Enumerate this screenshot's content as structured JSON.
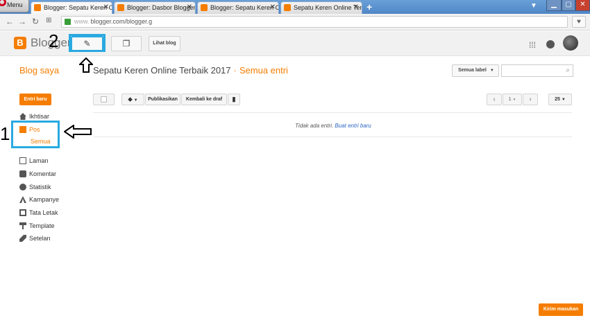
{
  "browser": {
    "menu_label": "Menu",
    "tabs": [
      {
        "title": "Blogger: Sepatu Keren Onl",
        "active": true
      },
      {
        "title": "Blogger: Dasbor Blogger",
        "active": false
      },
      {
        "title": "Blogger: Sepatu Keren On",
        "active": false
      },
      {
        "title": "Sepatu Keren Online Terba",
        "active": false
      }
    ],
    "tab_close": "✕",
    "new_tab": "+",
    "url_scheme": "www.",
    "url": "blogger.com/blogger.g"
  },
  "header": {
    "brand": "Blogger",
    "view_blog_label": "Lihat blog"
  },
  "annotations": {
    "num1": "1",
    "num2": "2",
    "box_color": "#29a9e0"
  },
  "title_row": {
    "my_blogs": "Blog saya",
    "blog_name": "Sepatu Keren Online Terbaik 2017",
    "dot": "·",
    "section": "Semua entri",
    "label_filter": "Semua label"
  },
  "sidebar": {
    "new_post": "Entri baru",
    "items": [
      {
        "label": "Ikhtisar",
        "icon": "home-icon"
      },
      {
        "label": "Pos",
        "icon": "posts-icon"
      },
      {
        "label": "Laman",
        "icon": "pages-icon"
      },
      {
        "label": "Komentar",
        "icon": "comment-icon"
      },
      {
        "label": "Statistik",
        "icon": "stats-icon"
      },
      {
        "label": "Kampanye",
        "icon": "campaign-icon"
      },
      {
        "label": "Tata Letak",
        "icon": "layout-icon"
      },
      {
        "label": "Template",
        "icon": "template-icon"
      },
      {
        "label": "Setelan",
        "icon": "wrench-icon"
      }
    ],
    "sub_all": "Semua"
  },
  "toolbar": {
    "publish": "Publikasikan",
    "revert_draft": "Kembali ke draf",
    "page": "1",
    "page_size": "25"
  },
  "content": {
    "empty_text": "Tidak ada entri.",
    "create_link": "Buat entri baru"
  },
  "feedback": "Kirim masukan",
  "colors": {
    "accent": "#f57d00",
    "link": "#2a66c1"
  }
}
